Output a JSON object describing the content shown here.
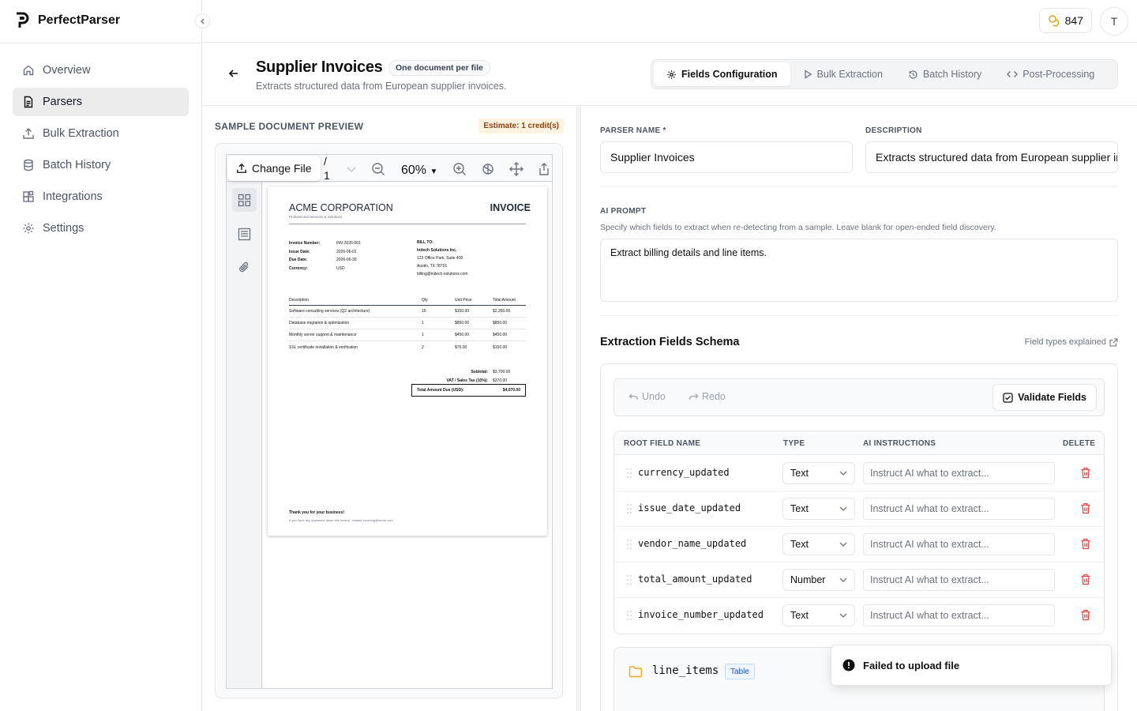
{
  "app": {
    "name": "PerfectParser",
    "credits": "847",
    "user_initial": "T"
  },
  "sidebar": {
    "items": [
      {
        "label": "Overview",
        "icon": "home-icon",
        "active": false
      },
      {
        "label": "Parsers",
        "icon": "document-icon",
        "active": true
      },
      {
        "label": "Bulk Extraction",
        "icon": "upload-icon",
        "active": false
      },
      {
        "label": "Batch History",
        "icon": "database-icon",
        "active": false
      },
      {
        "label": "Integrations",
        "icon": "puzzle-icon",
        "active": false
      },
      {
        "label": "Settings",
        "icon": "gear-icon",
        "active": false
      }
    ]
  },
  "header": {
    "title": "Supplier Invoices",
    "badge": "One document per file",
    "subtitle": "Extracts structured data from European supplier invoices.",
    "tabs": [
      {
        "label": "Fields Configuration",
        "active": true
      },
      {
        "label": "Bulk Extraction",
        "active": false
      },
      {
        "label": "Batch History",
        "active": false
      },
      {
        "label": "Post-Processing",
        "active": false
      }
    ]
  },
  "preview": {
    "section_title": "SAMPLE DOCUMENT PREVIEW",
    "estimate": "Estimate: 1 credit(s)",
    "change_file": "Change File",
    "page_sep": "/",
    "page_total": "1",
    "zoom": "60%",
    "invoice": {
      "company": "ACME CORPORATION",
      "tagline": "Professional Services & Solutions",
      "doc_title": "INVOICE",
      "meta": [
        {
          "k": "Invoice Number:",
          "v": "INV-2026-001"
        },
        {
          "k": "Issue Date:",
          "v": "2026-06-01"
        },
        {
          "k": "Due Date:",
          "v": "2026-06-30"
        },
        {
          "k": "Currency:",
          "v": "USD"
        }
      ],
      "bill_to_label": "BILL TO:",
      "bill_to_name": "Initech Solutions Inc.",
      "bill_to_addr1": "123 Office Park, Suite 400",
      "bill_to_addr2": "Austin, TX 78701",
      "bill_to_email": "billing@initech-solutions.com",
      "cols": {
        "desc": "Description",
        "qty": "Qty",
        "price": "Unit Price",
        "total": "Total Amount"
      },
      "lines": [
        {
          "desc": "Software consulting services (Q2 architecture)",
          "qty": "15",
          "price": "$150.00",
          "total": "$2,250.00"
        },
        {
          "desc": "Database migration & optimization",
          "qty": "1",
          "price": "$850.00",
          "total": "$850.00"
        },
        {
          "desc": "Monthly server support & maintenance",
          "qty": "1",
          "price": "$450.00",
          "total": "$450.00"
        },
        {
          "desc": "SSL certificate installation & verification",
          "qty": "2",
          "price": "$75.00",
          "total": "$150.00"
        }
      ],
      "subtotal_label": "Subtotal:",
      "subtotal": "$3,700.00",
      "vat_label": "VAT / Sales Tax (10%):",
      "vat": "$370.00",
      "due_label": "Total Amount Due (USD):",
      "due": "$4,070.00",
      "thanks": "Thank you for your business!",
      "footer": "If you have any questions about this invoice, contact invoicing@acme.com"
    }
  },
  "config": {
    "parser_name_label": "PARSER NAME *",
    "parser_name": "Supplier Invoices",
    "description_label": "DESCRIPTION",
    "description": "Extracts structured data from European supplier invoices.",
    "ai_prompt_label": "AI PROMPT",
    "ai_prompt_help": "Specify which fields to extract when re-detecting from a sample. Leave blank for open-ended field discovery.",
    "ai_prompt": "Extract billing details and line items.",
    "schema_title": "Extraction Fields Schema",
    "field_types_link": "Field types explained",
    "undo": "Undo",
    "redo": "Redo",
    "validate": "Validate Fields",
    "cols": {
      "name": "ROOT FIELD NAME",
      "type": "TYPE",
      "instr": "AI INSTRUCTIONS",
      "delete": "DELETE"
    },
    "instr_placeholder": "Instruct AI what to extract...",
    "fields": [
      {
        "name": "currency_updated",
        "type": "Text"
      },
      {
        "name": "issue_date_updated",
        "type": "Text"
      },
      {
        "name": "vendor_name_updated",
        "type": "Text"
      },
      {
        "name": "total_amount_updated",
        "type": "Number"
      },
      {
        "name": "invoice_number_updated",
        "type": "Text"
      }
    ],
    "line_items": {
      "name": "line_items",
      "badge": "Table"
    }
  },
  "toast": {
    "message": "Failed to upload file"
  }
}
